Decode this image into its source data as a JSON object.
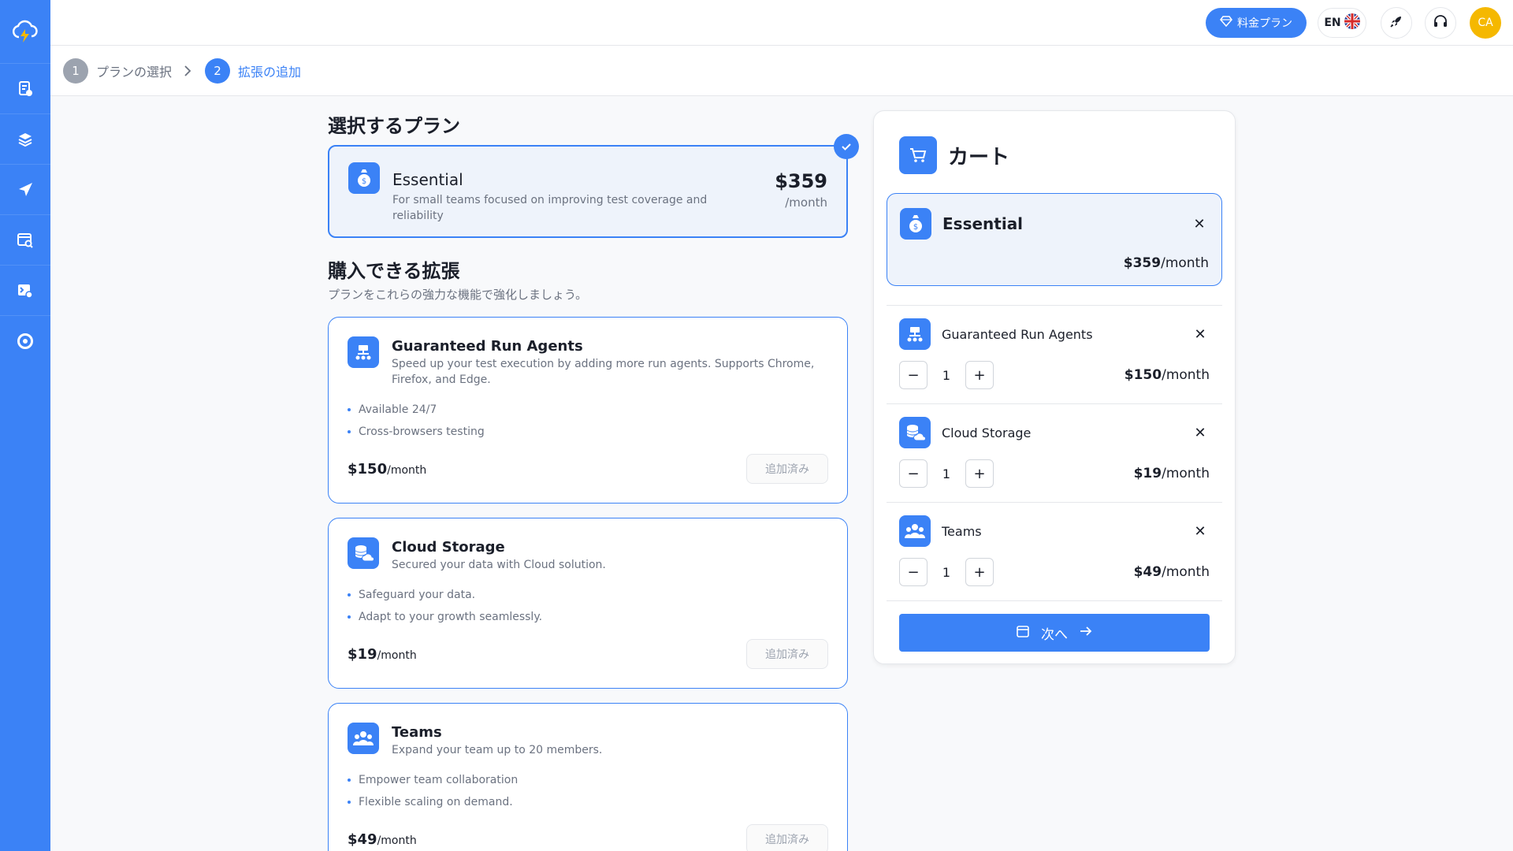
{
  "topbar": {
    "pricing_label": "料金プラン",
    "lang": "EN",
    "avatar_initials": "CA"
  },
  "steps": [
    {
      "num": "1",
      "label": "プランの選択"
    },
    {
      "num": "2",
      "label": "拡張の追加"
    }
  ],
  "selected_plan": {
    "heading": "選択するプラン",
    "name": "Essential",
    "desc": "For small teams focused on improving test coverage and reliability",
    "price": "$359",
    "period": "/month"
  },
  "extensions": {
    "heading": "購入できる拡張",
    "subtitle": "プランをこれらの強力な機能で強化しましょう。",
    "items": [
      {
        "name": "Guaranteed Run Agents",
        "desc": "Speed up your test execution by adding more run agents. Supports Chrome, Firefox, and Edge.",
        "bullets": [
          "Available 24/7",
          "Cross-browsers testing"
        ],
        "price": "$150",
        "period": "/month",
        "button": "追加済み"
      },
      {
        "name": "Cloud Storage",
        "desc": "Secured your data with Cloud solution.",
        "bullets": [
          "Safeguard your data.",
          "Adapt to your growth seamlessly."
        ],
        "price": "$19",
        "period": "/month",
        "button": "追加済み"
      },
      {
        "name": "Teams",
        "desc": "Expand your team up to 20 members.",
        "bullets": [
          "Empower team collaboration",
          "Flexible scaling on demand."
        ],
        "price": "$49",
        "period": "/month",
        "button": "追加済み"
      }
    ]
  },
  "cart": {
    "title": "カート",
    "plan": {
      "name": "Essential",
      "price": "$359",
      "period": "/month"
    },
    "items": [
      {
        "name": "Guaranteed Run Agents",
        "qty": "1",
        "price": "$150",
        "period": "/month"
      },
      {
        "name": "Cloud Storage",
        "qty": "1",
        "price": "$19",
        "period": "/month"
      },
      {
        "name": "Teams",
        "qty": "1",
        "price": "$49",
        "period": "/month"
      }
    ],
    "next_label": "次へ"
  },
  "colors": {
    "accent": "#3b82f6",
    "avatar": "#f5b800"
  }
}
